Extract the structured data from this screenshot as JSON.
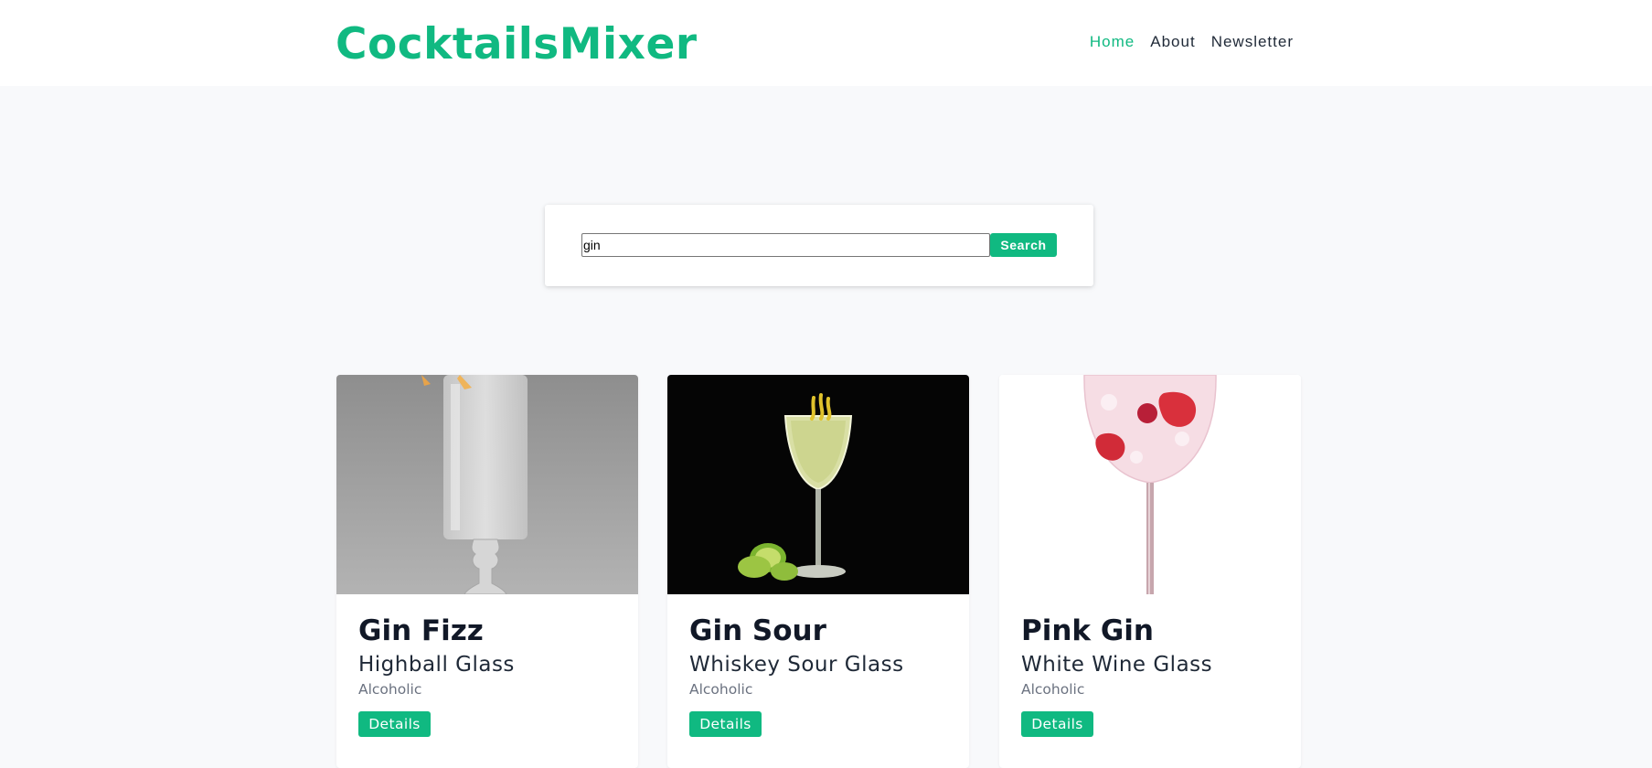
{
  "brand": {
    "name": "CocktailsMixer",
    "color": "#10b981"
  },
  "nav": {
    "items": [
      {
        "label": "Home",
        "active": true
      },
      {
        "label": "About",
        "active": false
      },
      {
        "label": "Newsletter",
        "active": false
      }
    ]
  },
  "search": {
    "value": "gin",
    "button_label": "Search"
  },
  "cocktails": [
    {
      "name": "Gin Fizz",
      "glass": "Highball Glass",
      "type": "Alcoholic",
      "button_label": "Details",
      "image_icon": "gin-fizz-photo"
    },
    {
      "name": "Gin Sour",
      "glass": "Whiskey Sour Glass",
      "type": "Alcoholic",
      "button_label": "Details",
      "image_icon": "gin-sour-photo"
    },
    {
      "name": "Pink Gin",
      "glass": "White Wine Glass",
      "type": "Alcoholic",
      "button_label": "Details",
      "image_icon": "pink-gin-photo"
    }
  ]
}
